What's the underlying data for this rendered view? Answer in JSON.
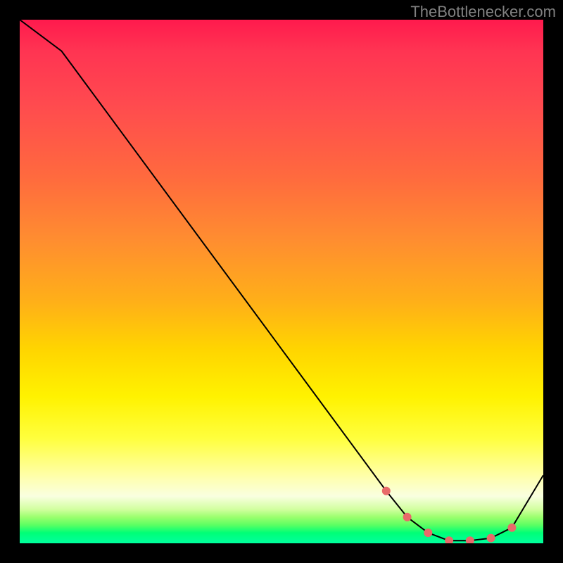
{
  "watermark": "TheBottlenecker.com",
  "chart_data": {
    "type": "line",
    "title": "",
    "xlabel": "",
    "ylabel": "",
    "xlim": [
      0,
      100
    ],
    "ylim": [
      0,
      100
    ],
    "series": [
      {
        "name": "bottleneck-curve",
        "x": [
          0,
          8,
          70,
          74,
          78,
          82,
          86,
          90,
          94,
          100
        ],
        "y": [
          100,
          94,
          10,
          5,
          2,
          0.5,
          0.5,
          1,
          3,
          13
        ],
        "color": "#000000",
        "stroke_width": 2
      }
    ],
    "highlight": {
      "name": "optimal-range-markers",
      "x": [
        70,
        74,
        78,
        82,
        86,
        90,
        94
      ],
      "y": [
        10,
        5,
        2,
        0.5,
        0.5,
        1,
        3
      ],
      "marker_color": "#e86a6a",
      "marker_radius": 6
    },
    "background": {
      "type": "vertical-gradient",
      "stops": [
        {
          "pos": 0.0,
          "color": "#ff1a4d"
        },
        {
          "pos": 0.5,
          "color": "#ffb018"
        },
        {
          "pos": 0.8,
          "color": "#ffff3e"
        },
        {
          "pos": 1.0,
          "color": "#00ff9e"
        }
      ]
    }
  }
}
